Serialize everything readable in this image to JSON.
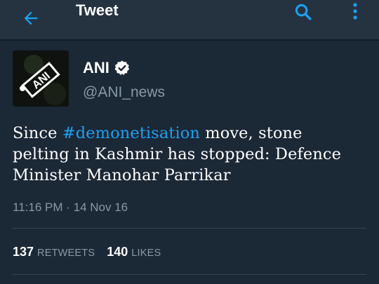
{
  "appbar": {
    "title": "Tweet",
    "back_icon": "arrow-left-icon",
    "search_icon": "search-icon",
    "more_icon": "more-vertical-icon"
  },
  "tweet": {
    "author": {
      "display_name": "ANI",
      "handle": "@ANI_news",
      "verified": true,
      "avatar_text": "ANI"
    },
    "text_segments": [
      {
        "text": "Since ",
        "type": "text"
      },
      {
        "text": "#demonetisation",
        "type": "hashtag"
      },
      {
        "text": " move, stone pelting in Kashmir has stopped: Defence Minister Manohar Parrikar",
        "type": "text"
      }
    ],
    "timestamp": "11:16 PM · 14 Nov 16",
    "stats": {
      "retweets_count": "137",
      "retweets_label": "RETWEETS",
      "likes_count": "140",
      "likes_label": "LIKES"
    }
  },
  "colors": {
    "background": "#1b2836",
    "appbar": "#253341",
    "accent": "#1da1f2",
    "secondary_text": "#8899a6"
  }
}
